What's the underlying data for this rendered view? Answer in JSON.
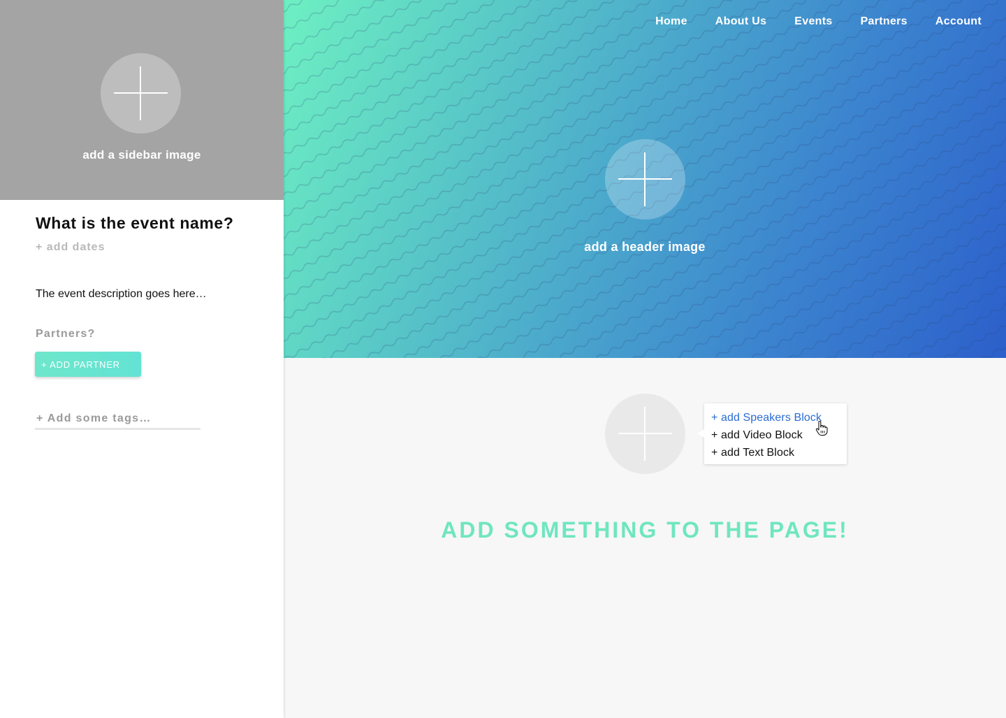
{
  "sidebar": {
    "image_caption": "add a sidebar image",
    "event_name": "What is the event name?",
    "add_dates": "+ add dates",
    "description": "The event description goes here…",
    "partners_label": "Partners?",
    "add_partner_button": "+ ADD PARTNER",
    "tags_placeholder": "+ Add some tags…"
  },
  "header": {
    "nav": [
      "Home",
      "About Us",
      "Events",
      "Partners",
      "Account"
    ],
    "image_caption": "add a header image"
  },
  "content": {
    "block_menu": {
      "items": [
        "+ add Speakers Block",
        "+ add Video Block",
        "+ add Text Block"
      ],
      "hovered_item": "+ add Speakers Block"
    },
    "cta": "ADD SOMETHING TO THE PAGE!"
  },
  "colors": {
    "accent_teal": "#6fe6bf",
    "header_gradient_start": "#6ef0c2",
    "header_gradient_end": "#2c5fca",
    "link_blue": "#2a6bd3",
    "sidebar_image_bg": "#a4a4a4"
  }
}
